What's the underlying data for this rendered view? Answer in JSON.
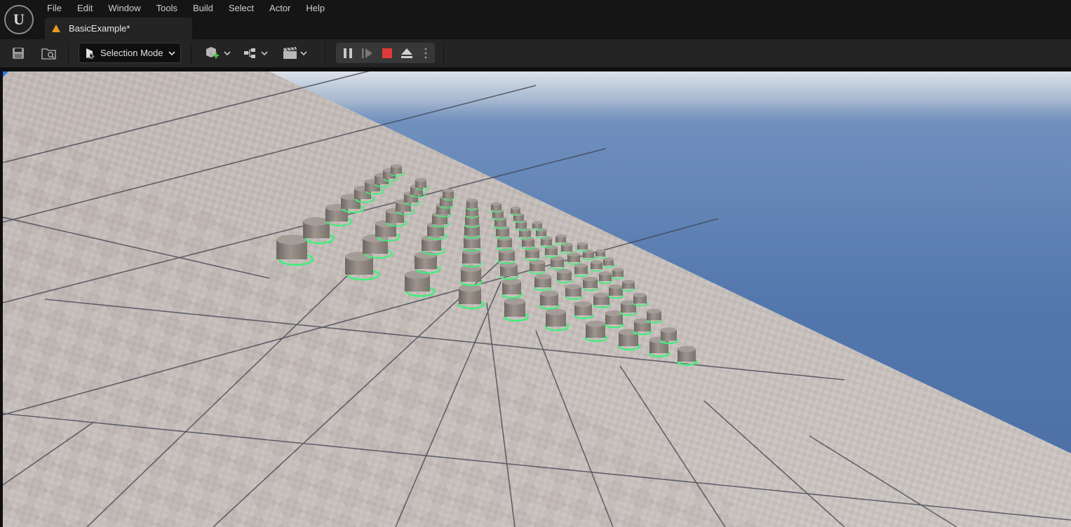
{
  "app": {
    "logo_letter": "U",
    "accent_color": "#e79a25"
  },
  "menu": [
    "File",
    "Edit",
    "Window",
    "Tools",
    "Build",
    "Select",
    "Actor",
    "Help"
  ],
  "document_tab": {
    "label": "BasicExample*",
    "icon": "level-icon"
  },
  "toolbar": {
    "save_icon": "save-icon",
    "browse_icon": "content-browser-icon",
    "mode_label": "Selection Mode",
    "mode_icon": "selection-mode-icon",
    "add_actor_icon": "add-actor-icon",
    "blueprint_icon": "blueprint-icon",
    "cinematics_icon": "cinematics-icon",
    "play_controls": [
      "pause-icon",
      "skip-frame-icon",
      "stop-icon",
      "eject-icon",
      "more-options-icon"
    ],
    "stop_color": "#e03a3a"
  },
  "viewport": {
    "sky_color": "#4f76ad",
    "floor_color": "#c4bcb8",
    "selection_color": "#3ef07a"
  }
}
